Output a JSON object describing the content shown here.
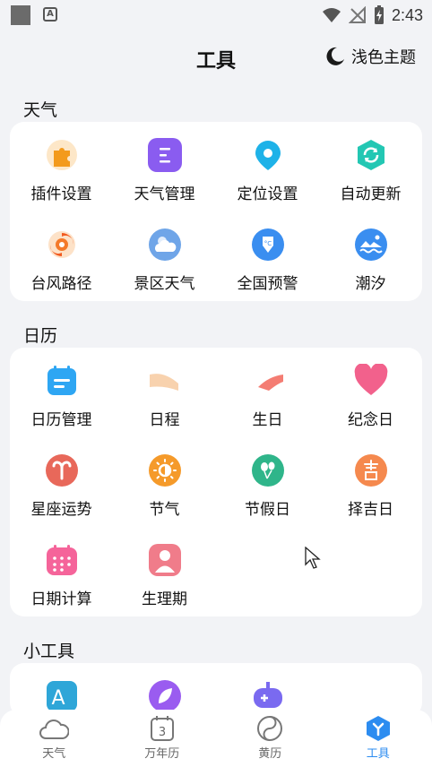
{
  "status_bar": {
    "time": "2:43"
  },
  "header": {
    "title": "工具",
    "theme_label": "浅色主题"
  },
  "sections": {
    "weather": {
      "title": "天气",
      "items": [
        {
          "label": "插件设置",
          "icon": "puzzle-icon"
        },
        {
          "label": "天气管理",
          "icon": "list-icon"
        },
        {
          "label": "定位设置",
          "icon": "location-pin-icon"
        },
        {
          "label": "自动更新",
          "icon": "refresh-icon"
        },
        {
          "label": "台风路径",
          "icon": "typhoon-icon"
        },
        {
          "label": "景区天气",
          "icon": "cloud-sun-icon"
        },
        {
          "label": "全国预警",
          "icon": "warning-shield-icon"
        },
        {
          "label": "潮汐",
          "icon": "tide-icon"
        }
      ]
    },
    "calendar": {
      "title": "日历",
      "items": [
        {
          "label": "日历管理",
          "icon": "calendar-manage-icon"
        },
        {
          "label": "日程",
          "icon": "schedule-icon"
        },
        {
          "label": "生日",
          "icon": "birthday-icon"
        },
        {
          "label": "纪念日",
          "icon": "heart-icon"
        },
        {
          "label": "星座运势",
          "icon": "aries-icon"
        },
        {
          "label": "节气",
          "icon": "solar-term-icon"
        },
        {
          "label": "节假日",
          "icon": "balloon-icon"
        },
        {
          "label": "择吉日",
          "icon": "auspicious-icon"
        },
        {
          "label": "日期计算",
          "icon": "calendar-grid-icon"
        },
        {
          "label": "生理期",
          "icon": "period-icon"
        }
      ]
    },
    "tools": {
      "title": "小工具",
      "items": [
        {
          "label": "",
          "icon": "font-icon"
        },
        {
          "label": "",
          "icon": "leaf-icon"
        },
        {
          "label": "",
          "icon": "game-icon"
        }
      ]
    }
  },
  "tabbar": {
    "tabs": [
      {
        "label": "天气",
        "icon": "weather-tab-icon",
        "active": false
      },
      {
        "label": "万年历",
        "icon": "calendar-tab-icon",
        "active": false
      },
      {
        "label": "黄历",
        "icon": "almanac-tab-icon",
        "active": false
      },
      {
        "label": "工具",
        "icon": "tools-tab-icon",
        "active": true
      }
    ],
    "calendar_day": "3"
  },
  "colors": {
    "accent": "#2c8cf0",
    "background": "#f2f3f6",
    "card": "#ffffff"
  }
}
